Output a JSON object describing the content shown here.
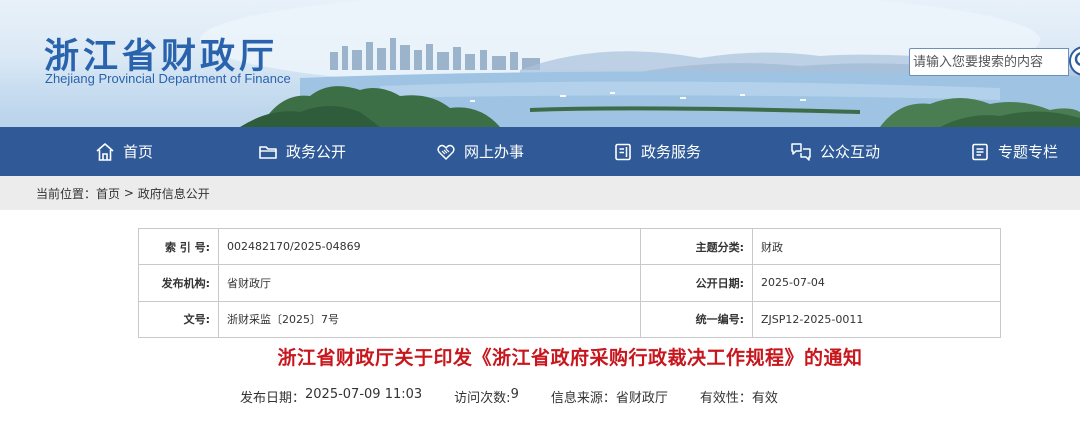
{
  "site": {
    "name_cn": "浙江省财政厅",
    "name_en": "Zhejiang Provincial Department of Finance"
  },
  "search": {
    "placeholder": "请输入您要搜索的内容"
  },
  "nav": [
    {
      "label": "首页",
      "icon": "home-icon"
    },
    {
      "label": "政务公开",
      "icon": "folder-icon"
    },
    {
      "label": "网上办事",
      "icon": "handshake-icon"
    },
    {
      "label": "政务服务",
      "icon": "document-icon"
    },
    {
      "label": "公众互动",
      "icon": "chat-icon"
    },
    {
      "label": "专题专栏",
      "icon": "list-icon"
    }
  ],
  "breadcrumb": {
    "prefix": "当前位置：",
    "home": "首页",
    "separator": " > ",
    "current": "政府信息公开"
  },
  "meta": {
    "index_label": "索 引 号:",
    "index_value": "002482170/2025-04869",
    "topic_label": "主题分类:",
    "topic_value": "财政",
    "publisher_label": "发布机构:",
    "publisher_value": "省财政厅",
    "open_date_label": "公开日期:",
    "open_date_value": "2025-07-04",
    "doc_no_label": "文号:",
    "doc_no_value": "浙财采监〔2025〕7号",
    "unified_label": "统一编号:",
    "unified_value": "ZJSP12-2025-0011"
  },
  "document": {
    "title": "浙江省财政厅关于印发《浙江省政府采购行政裁决工作规程》的通知",
    "publish_label": "发布日期：",
    "publish_value": "2025-07-09 11:03",
    "visits_label": "访问次数:",
    "visits_value": "9",
    "source_label": "信息来源：",
    "source_value": "省财政厅",
    "validity_label": "有效性：",
    "validity_value": "有效"
  },
  "colors": {
    "brand_blue": "#2a63ad",
    "nav_bg": "#2f5a97",
    "title_red": "#c8161d",
    "breadcrumb_bg": "#ececec"
  }
}
